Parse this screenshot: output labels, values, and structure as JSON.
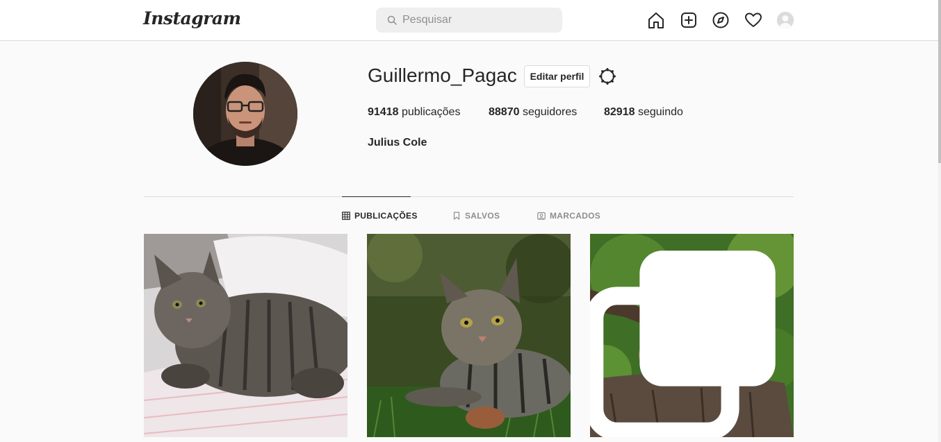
{
  "header": {
    "logo": "Instagram",
    "search_placeholder": "Pesquisar",
    "nav_icons": [
      "home-icon",
      "new-post-icon",
      "explore-icon",
      "heart-icon",
      "avatar"
    ]
  },
  "profile": {
    "username": "Guillermo_Pagac",
    "edit_button": "Editar perfil",
    "posts_count": "91418",
    "posts_label": " publicações",
    "followers_count": "88870",
    "followers_label": " seguidores",
    "following_count": "82918",
    "following_label": " seguindo",
    "full_name": "Julius Cole"
  },
  "tabs": [
    {
      "label": "PUBLICAÇÕES",
      "icon": "grid-icon",
      "active": true
    },
    {
      "label": "SALVOS",
      "icon": "bookmark-icon",
      "active": false
    },
    {
      "label": "MARCADOS",
      "icon": "tagged-icon",
      "active": false
    }
  ],
  "posts": [
    {
      "subject": "tabby cat lying on bed",
      "multi": false
    },
    {
      "subject": "tabby cat lying in grass",
      "multi": false
    },
    {
      "subject": "wild kitten on tree stump",
      "multi": true
    }
  ],
  "colors": {
    "background": "#fafafa",
    "border": "#dbdbdb",
    "text": "#262626",
    "muted": "#8e8e8e"
  }
}
